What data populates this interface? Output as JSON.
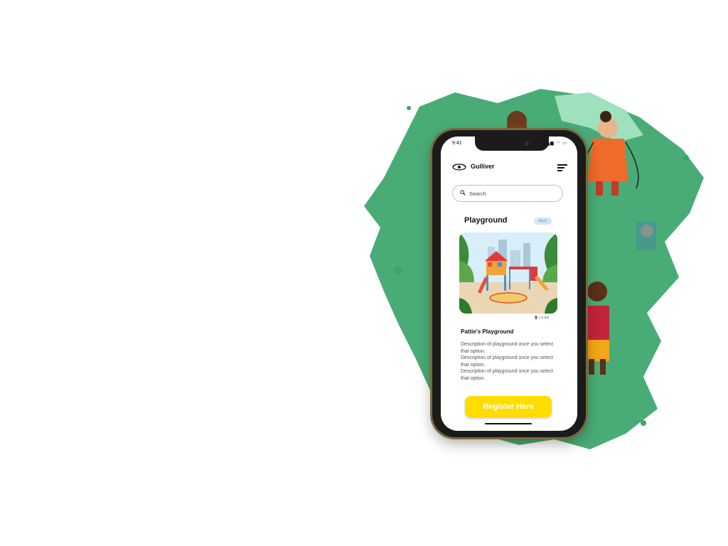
{
  "status_bar": {
    "time": "9:41",
    "icons": "▂▄▆ ◠ ▭"
  },
  "app": {
    "brand": "Gulliver"
  },
  "search": {
    "placeholder": "Search"
  },
  "section": {
    "title": "Playground",
    "badge": "PLAY"
  },
  "card": {
    "distance": "1.3 KM",
    "name": "Pattie's Playground",
    "description": [
      "Description of playground once you select that option.",
      "Description of playground once you select that option.",
      "Description of playground once you select that option."
    ]
  },
  "cta": {
    "label": "Register Here"
  },
  "colors": {
    "accent": "#ffdd00",
    "splash": "#3aa56a",
    "badge": "#cfe6fb"
  },
  "icons": [
    "logo-icon",
    "menu-icon",
    "search-icon",
    "pin-icon"
  ]
}
